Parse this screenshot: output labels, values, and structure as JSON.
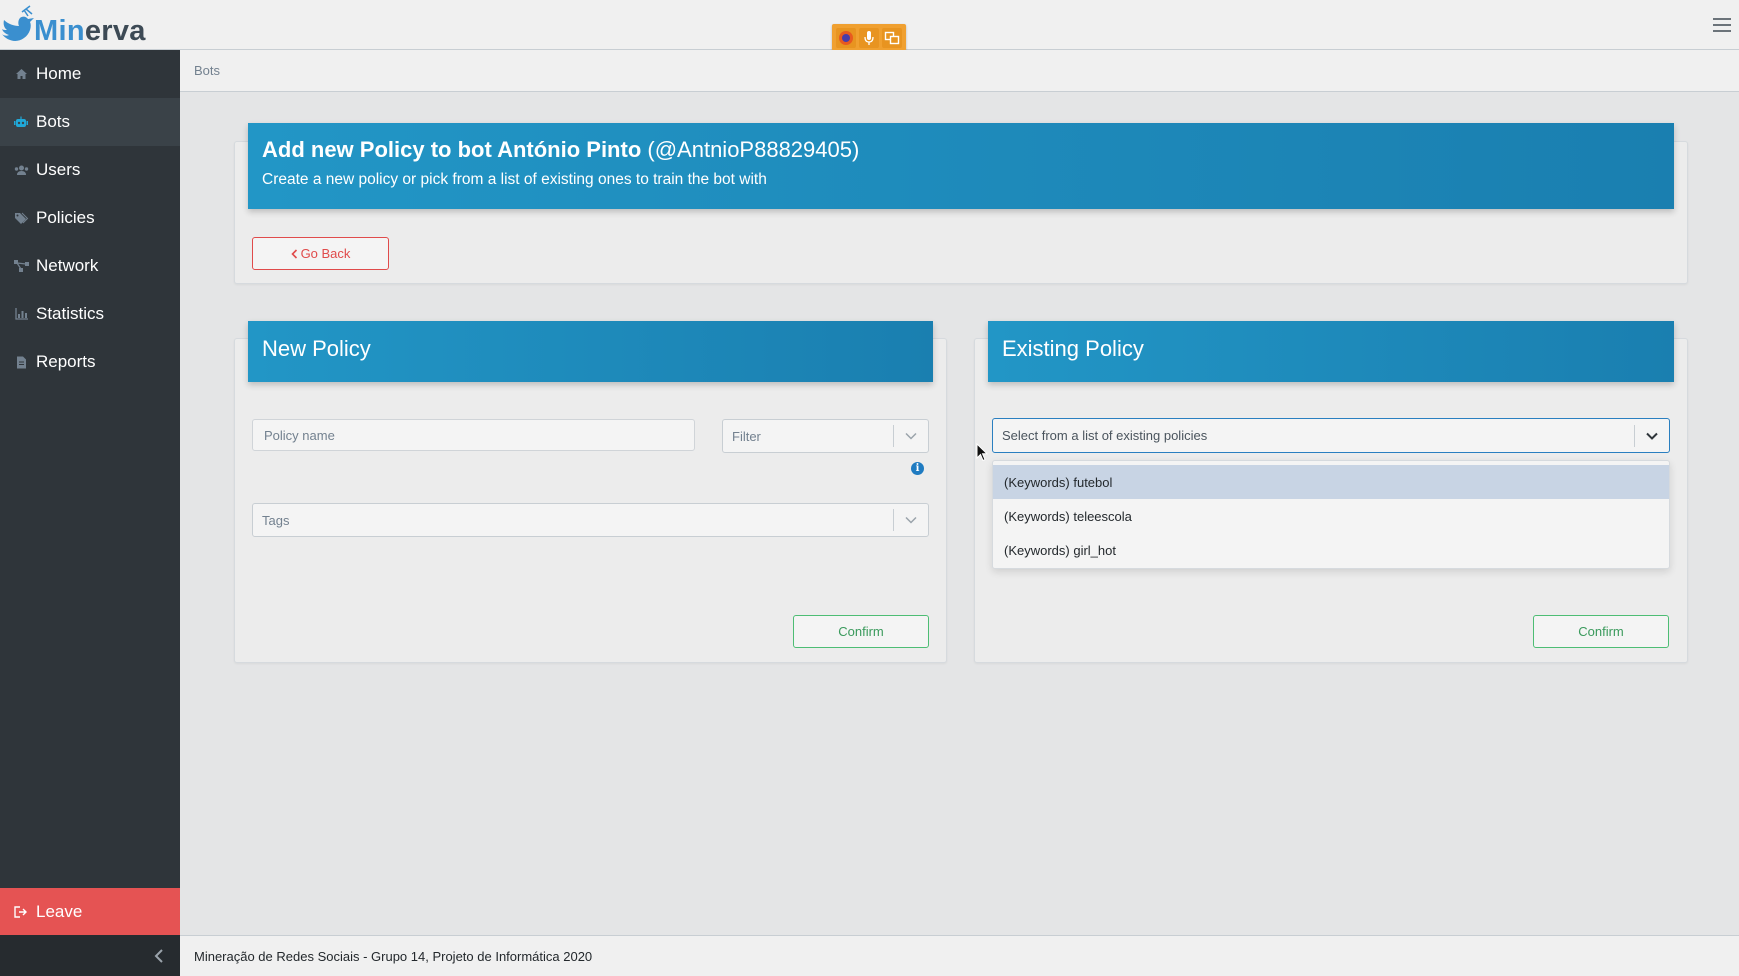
{
  "app": {
    "logo_part1": "Min",
    "logo_part2": "erva"
  },
  "sidebar": {
    "items": [
      {
        "label": "Home",
        "icon": "home-icon"
      },
      {
        "label": "Bots",
        "icon": "robot-icon"
      },
      {
        "label": "Users",
        "icon": "users-icon"
      },
      {
        "label": "Policies",
        "icon": "tags-icon"
      },
      {
        "label": "Network",
        "icon": "network-icon"
      },
      {
        "label": "Statistics",
        "icon": "chart-icon"
      },
      {
        "label": "Reports",
        "icon": "file-icon"
      }
    ],
    "active": "Bots",
    "leave_label": "Leave"
  },
  "breadcrumb": {
    "current": "Bots"
  },
  "header_card": {
    "title": "Add new Policy to bot António Pinto",
    "handle": "(@AntnioP88829405)",
    "subtitle": "Create a new policy or pick from a list of existing ones to train the bot with",
    "go_back_label": "Go Back"
  },
  "new_policy": {
    "title": "New Policy",
    "policy_name_placeholder": "Policy name",
    "filter_placeholder": "Filter",
    "tags_placeholder": "Tags",
    "confirm_label": "Confirm"
  },
  "existing_policy": {
    "title": "Existing Policy",
    "select_placeholder": "Select from a list of existing policies",
    "options": [
      "(Keywords) futebol",
      "(Keywords) teleescola",
      "(Keywords) girl_hot"
    ],
    "highlighted_index": 0,
    "confirm_label": "Confirm"
  },
  "footer": {
    "text": "Mineração de Redes Sociais - Grupo 14, Projeto de Informática 2020"
  },
  "colors": {
    "sidebar_bg": "#2f353a",
    "header_blue": "#2296c6",
    "leave_red": "#e55353",
    "confirm_green": "#4dbd74"
  }
}
